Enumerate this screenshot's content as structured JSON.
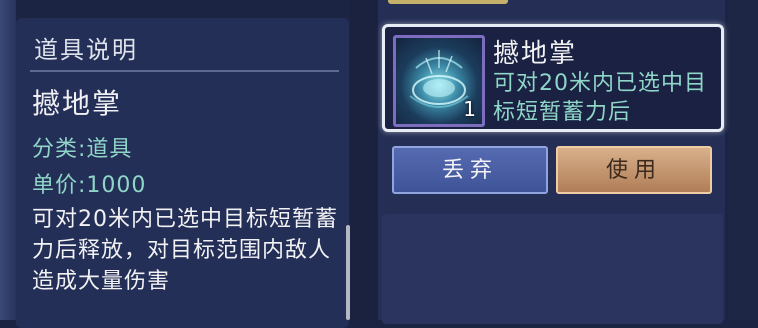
{
  "description_panel": {
    "title": "道具说明",
    "item_name": "撼地掌",
    "category_label": "分类:",
    "category_value": "道具",
    "price_label": "单价:",
    "price_value": "1000",
    "description": "可对20米内已选中目标短暂蓄力后释放，对目标范围内敌人造成大量伤害"
  },
  "item_card": {
    "name": "撼地掌",
    "description": "可对20米内已选中目标短暂蓄力后",
    "count": "1",
    "icon": "ground-palm-skill-icon"
  },
  "actions": {
    "discard_label": "丢弃",
    "use_label": "使用"
  },
  "colors": {
    "accent_text": "#8fd6c8",
    "panel_bg": "#242f57",
    "use_button": "#c9986e",
    "discard_button": "#4a5fa6"
  }
}
